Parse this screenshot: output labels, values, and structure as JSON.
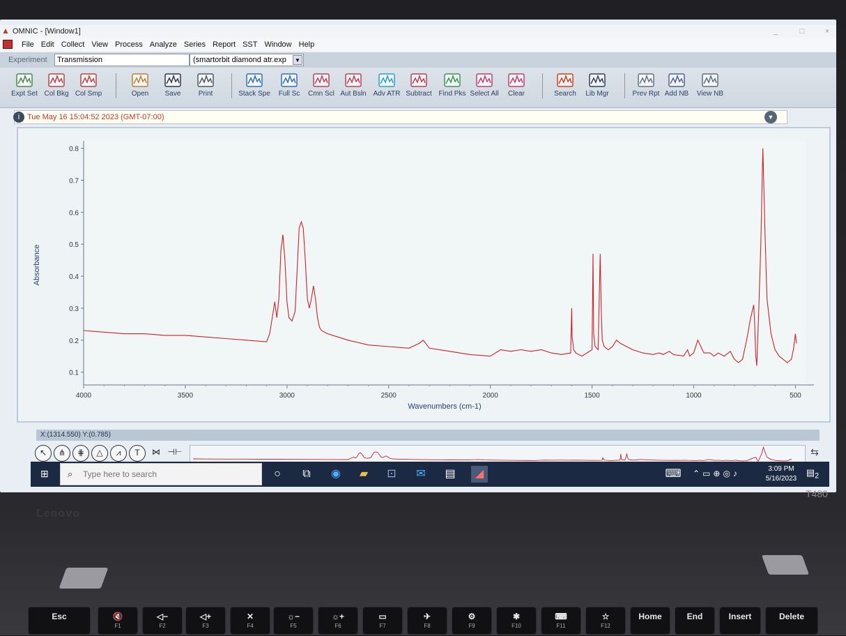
{
  "window": {
    "title": "OMNIC - [Window1]",
    "controls": [
      "_",
      "□",
      "×"
    ]
  },
  "menu": [
    "File",
    "Edit",
    "Collect",
    "View",
    "Process",
    "Analyze",
    "Series",
    "Report",
    "SST",
    "Window",
    "Help"
  ],
  "experiment": {
    "label": "Experiment",
    "mode": "Transmission",
    "file": "(smartorbit diamond atr.exp"
  },
  "toolbar": [
    {
      "label": "Expt Set",
      "icon": "experiment-setup-icon"
    },
    {
      "label": "Col Bkg",
      "icon": "collect-background-icon"
    },
    {
      "label": "Col Smp",
      "icon": "collect-sample-icon"
    },
    {
      "label": "Open",
      "icon": "open-folder-icon"
    },
    {
      "label": "Save",
      "icon": "save-disk-icon"
    },
    {
      "label": "Print",
      "icon": "printer-icon"
    },
    {
      "label": "Stack Spe",
      "icon": "stack-spectra-icon"
    },
    {
      "label": "Full Sc",
      "icon": "full-scale-icon"
    },
    {
      "label": "Cmn Scl",
      "icon": "common-scale-icon"
    },
    {
      "label": "Aut Bsln",
      "icon": "auto-baseline-icon"
    },
    {
      "label": "Adv ATR",
      "icon": "advanced-atr-icon"
    },
    {
      "label": "Subtract",
      "icon": "subtract-icon"
    },
    {
      "label": "Find Pks",
      "icon": "find-peaks-icon"
    },
    {
      "label": "Select All",
      "icon": "select-all-icon"
    },
    {
      "label": "Clear",
      "icon": "clear-icon"
    },
    {
      "label": "Search",
      "icon": "search-icon"
    },
    {
      "label": "Lib Mgr",
      "icon": "library-manager-icon"
    },
    {
      "label": "Prev Rpt",
      "icon": "preview-report-icon"
    },
    {
      "label": "Add NB",
      "icon": "add-notebook-icon"
    },
    {
      "label": "View NB",
      "icon": "view-notebook-icon"
    }
  ],
  "timestamp": "Tue May 16 15:04:52 2023 (GMT-07:00)",
  "coordinates": "X:(1314.550) Y:(0.785)",
  "chart_data": {
    "type": "line",
    "title": "",
    "xlabel": "Wavenumbers (cm-1)",
    "ylabel": "Absorbance",
    "xlim": [
      4000,
      450
    ],
    "ylim": [
      0.06,
      0.81
    ],
    "x_reversed": true,
    "xticks": [
      4000,
      3500,
      3000,
      2500,
      2000,
      1500,
      1000,
      500
    ],
    "yticks": [
      0.1,
      0.2,
      0.3,
      0.4,
      0.5,
      0.6,
      0.7,
      0.8
    ],
    "grid": false,
    "series": [
      {
        "color": "#d0202a",
        "x": [
          4000,
          3900,
          3800,
          3700,
          3600,
          3500,
          3400,
          3300,
          3200,
          3100,
          3085,
          3070,
          3060,
          3050,
          3040,
          3030,
          3020,
          3010,
          3000,
          2990,
          2975,
          2960,
          2950,
          2940,
          2930,
          2920,
          2910,
          2900,
          2890,
          2880,
          2870,
          2860,
          2850,
          2840,
          2830,
          2800,
          2750,
          2700,
          2600,
          2500,
          2400,
          2350,
          2330,
          2300,
          2200,
          2100,
          2000,
          1950,
          1900,
          1850,
          1800,
          1750,
          1700,
          1650,
          1605,
          1600,
          1598,
          1590,
          1580,
          1550,
          1500,
          1495,
          1492,
          1485,
          1470,
          1460,
          1455,
          1450,
          1440,
          1420,
          1400,
          1380,
          1360,
          1300,
          1250,
          1200,
          1170,
          1150,
          1120,
          1100,
          1050,
          1030,
          1020,
          1000,
          980,
          950,
          920,
          900,
          880,
          850,
          820,
          800,
          780,
          760,
          740,
          720,
          705,
          700,
          695,
          690,
          680,
          670,
          660,
          650,
          640,
          620,
          600,
          580,
          560,
          540,
          520,
          510,
          500,
          495
        ],
        "y": [
          0.23,
          0.225,
          0.22,
          0.22,
          0.215,
          0.215,
          0.21,
          0.205,
          0.2,
          0.195,
          0.22,
          0.28,
          0.32,
          0.27,
          0.33,
          0.48,
          0.53,
          0.45,
          0.32,
          0.27,
          0.26,
          0.29,
          0.42,
          0.55,
          0.57,
          0.55,
          0.45,
          0.33,
          0.3,
          0.33,
          0.37,
          0.33,
          0.27,
          0.24,
          0.23,
          0.22,
          0.21,
          0.2,
          0.185,
          0.18,
          0.175,
          0.19,
          0.2,
          0.175,
          0.165,
          0.155,
          0.15,
          0.17,
          0.165,
          0.17,
          0.165,
          0.17,
          0.16,
          0.155,
          0.16,
          0.3,
          0.21,
          0.17,
          0.16,
          0.15,
          0.17,
          0.47,
          0.22,
          0.18,
          0.17,
          0.47,
          0.3,
          0.2,
          0.18,
          0.17,
          0.18,
          0.2,
          0.19,
          0.17,
          0.16,
          0.155,
          0.16,
          0.155,
          0.165,
          0.155,
          0.15,
          0.17,
          0.15,
          0.16,
          0.2,
          0.16,
          0.16,
          0.15,
          0.16,
          0.15,
          0.165,
          0.14,
          0.13,
          0.14,
          0.2,
          0.27,
          0.31,
          0.25,
          0.15,
          0.12,
          0.3,
          0.5,
          0.8,
          0.55,
          0.33,
          0.22,
          0.17,
          0.15,
          0.14,
          0.13,
          0.14,
          0.17,
          0.22,
          0.19
        ]
      }
    ]
  },
  "bottom_tools": [
    "select-arrow-icon",
    "region-tool-icon",
    "peak-label-icon",
    "height-tool-icon",
    "area-tool-icon",
    "text-tool-icon",
    "zoom-shrink-icon",
    "zoom-expand-icon"
  ],
  "taskbar": {
    "search_placeholder": "Type here to search",
    "time": "3:09 PM",
    "date": "5/16/2023",
    "notifications": "2"
  },
  "laptop": {
    "brand": "Lenovo",
    "model": "T480",
    "keys": [
      {
        "label": "Esc",
        "sub": ""
      },
      {
        "label": "🔇",
        "sub": "F1"
      },
      {
        "label": "◁−",
        "sub": "F2"
      },
      {
        "label": "◁+",
        "sub": "F3"
      },
      {
        "label": "✕",
        "sub": "F4"
      },
      {
        "label": "☼−",
        "sub": "F5"
      },
      {
        "label": "☼+",
        "sub": "F6"
      },
      {
        "label": "▭",
        "sub": "F7"
      },
      {
        "label": "✈",
        "sub": "F8"
      },
      {
        "label": "⚙",
        "sub": "F9"
      },
      {
        "label": "✱",
        "sub": "F10"
      },
      {
        "label": "⌨",
        "sub": "F11"
      },
      {
        "label": "☆",
        "sub": "F12"
      },
      {
        "label": "Home",
        "sub": ""
      },
      {
        "label": "End",
        "sub": ""
      },
      {
        "label": "Insert",
        "sub": ""
      },
      {
        "label": "Delete",
        "sub": ""
      }
    ]
  }
}
